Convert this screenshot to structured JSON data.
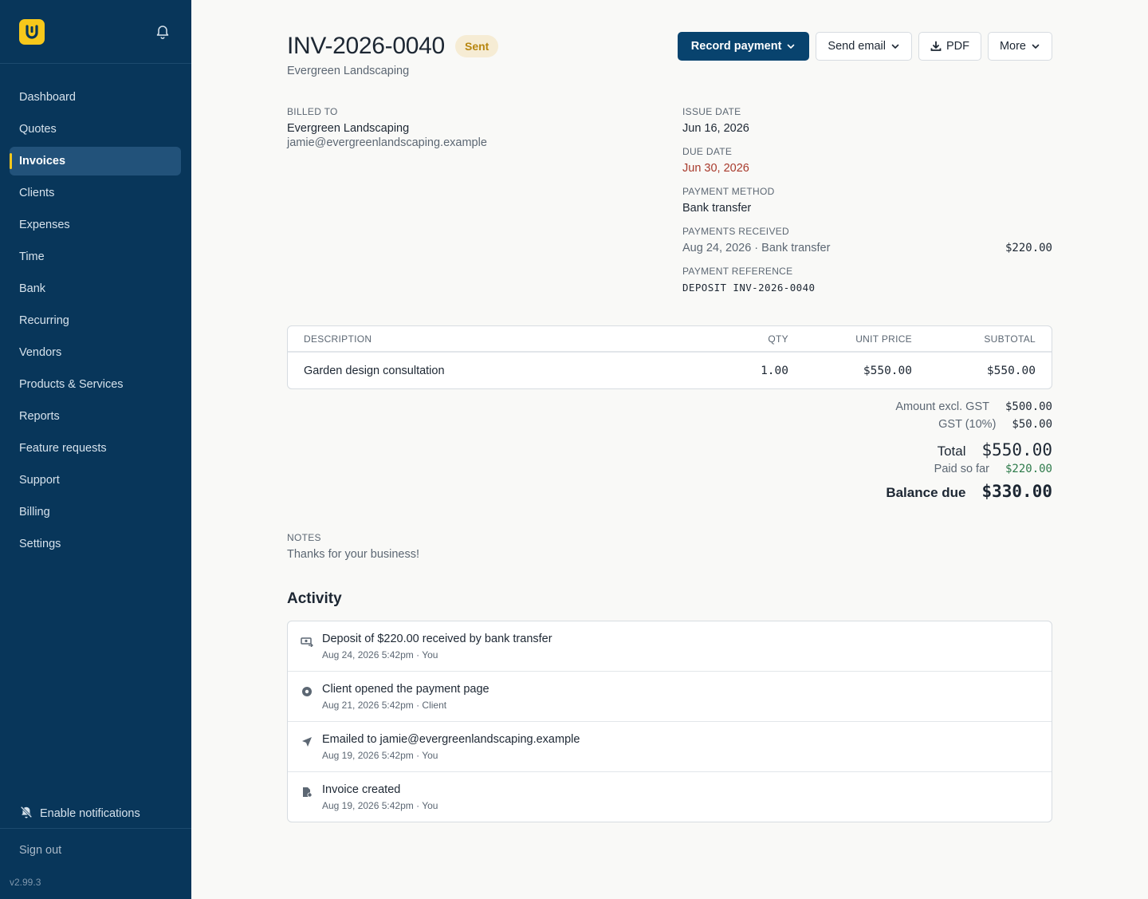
{
  "sidebar": {
    "logo_letter": "U",
    "nav": [
      {
        "label": "Dashboard",
        "active": false
      },
      {
        "label": "Quotes",
        "active": false
      },
      {
        "label": "Invoices",
        "active": true
      },
      {
        "label": "Clients",
        "active": false
      },
      {
        "label": "Expenses",
        "active": false
      },
      {
        "label": "Time",
        "active": false
      },
      {
        "label": "Bank",
        "active": false
      },
      {
        "label": "Recurring",
        "active": false
      },
      {
        "label": "Vendors",
        "active": false
      },
      {
        "label": "Products & Services",
        "active": false
      },
      {
        "label": "Reports",
        "active": false
      },
      {
        "label": "Feature requests",
        "active": false
      },
      {
        "label": "Support",
        "active": false
      },
      {
        "label": "Billing",
        "active": false
      },
      {
        "label": "Settings",
        "active": false
      }
    ],
    "enable_notifications": "Enable notifications",
    "sign_out": "Sign out",
    "version": "v2.99.3"
  },
  "header": {
    "invoice_number": "INV-2026-0040",
    "status": "Sent",
    "client_name": "Evergreen Landscaping",
    "buttons": {
      "record_payment": "Record payment",
      "send_email": "Send email",
      "pdf": "PDF",
      "more": "More"
    }
  },
  "billed_to": {
    "label": "BILLED TO",
    "name": "Evergreen Landscaping",
    "email": "jamie@evergreenlandscaping.example"
  },
  "meta": {
    "issue_date_label": "ISSUE DATE",
    "issue_date": "Jun 16, 2026",
    "due_date_label": "DUE DATE",
    "due_date": "Jun 30, 2026",
    "payment_method_label": "PAYMENT METHOD",
    "payment_method": "Bank transfer",
    "payments_received_label": "PAYMENTS RECEIVED",
    "payment_entry": "Aug 24, 2026 · Bank transfer",
    "payment_amount": "$220.00",
    "payment_reference_label": "PAYMENT REFERENCE",
    "payment_reference": "DEPOSIT INV-2026-0040"
  },
  "items": {
    "headers": {
      "description": "DESCRIPTION",
      "qty": "QTY",
      "unit_price": "UNIT PRICE",
      "subtotal": "SUBTOTAL"
    },
    "rows": [
      {
        "description": "Garden design consultation",
        "qty": "1.00",
        "unit_price": "$550.00",
        "subtotal": "$550.00"
      }
    ]
  },
  "totals": {
    "excl_label": "Amount excl. GST",
    "excl_value": "$500.00",
    "gst_label": "GST (10%)",
    "gst_value": "$50.00",
    "total_label": "Total",
    "total_value": "$550.00",
    "paid_label": "Paid so far",
    "paid_value": "$220.00",
    "balance_label": "Balance due",
    "balance_value": "$330.00"
  },
  "notes": {
    "label": "NOTES",
    "text": "Thanks for your business!"
  },
  "activity": {
    "title": "Activity",
    "items": [
      {
        "icon": "payment-icon",
        "text": "Deposit of $220.00 received by bank transfer",
        "meta": "Aug 24, 2026 5:42pm · You"
      },
      {
        "icon": "eye-icon",
        "text": "Client opened the payment page",
        "meta": "Aug 21, 2026 5:42pm · Client"
      },
      {
        "icon": "send-icon",
        "text": "Emailed to jamie@evergreenlandscaping.example",
        "meta": "Aug 19, 2026 5:42pm · You"
      },
      {
        "icon": "document-icon",
        "text": "Invoice created",
        "meta": "Aug 19, 2026 5:42pm · You"
      }
    ]
  },
  "colors": {
    "sidebar_bg": "#08365a",
    "accent": "#f7c81b",
    "primary_button": "#08436e",
    "overdue": "#a83a2c",
    "paid": "#2d7a4a"
  }
}
